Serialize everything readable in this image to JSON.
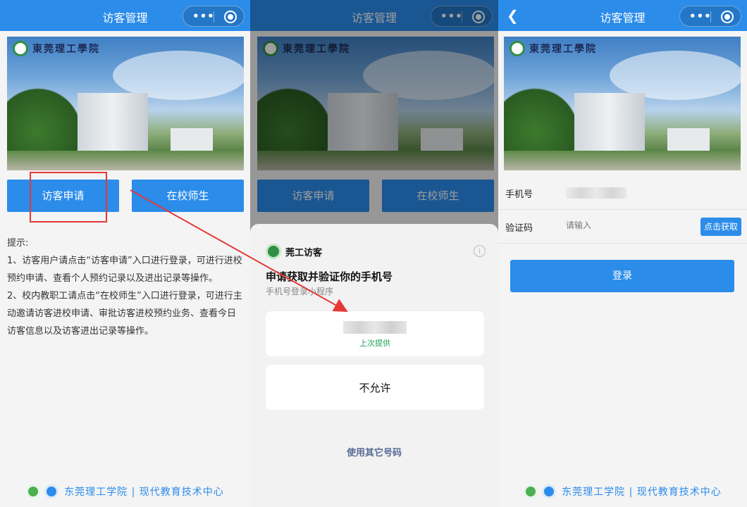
{
  "screen1": {
    "nav_title": "访客管理",
    "banner_logo_text": "東莞理工學院",
    "buttons": {
      "visitor_apply": "访客申请",
      "staff": "在校师生"
    },
    "tips_title": "提示:",
    "tip1": "1、访客用户请点击“访客申请”入口进行登录，可进行进校预约申请、查看个人预约记录以及进出记录等操作。",
    "tip2": "2、校内教职工请点击“在校师生”入口进行登录，可进行主动邀请访客进校申请、审批访客进校预约业务、查看今日访客信息以及访客进出记录等操作。",
    "footer": "东莞理工学院 | 现代教育技术中心"
  },
  "screen2": {
    "nav_title": "访客管理",
    "banner_logo_text": "東莞理工學院",
    "buttons": {
      "visitor_apply": "访客申请",
      "staff": "在校师生"
    },
    "app_name": "莞工访客",
    "request_title": "申请获取并验证你的手机号",
    "request_subtitle": "手机号登录小程序",
    "last_used": "上次提供",
    "deny": "不允许",
    "use_other": "使用其它号码"
  },
  "screen3": {
    "nav_title": "访客管理",
    "banner_logo_text": "東莞理工學院",
    "phone_label": "手机号",
    "code_label": "验证码",
    "code_placeholder": "请输入",
    "get_code": "点击获取",
    "login": "登录",
    "footer": "东莞理工学院 | 现代教育技术中心"
  },
  "colors": {
    "primary": "#2b8cea",
    "annotation": "#e53935",
    "green": "#23a05a"
  },
  "icons": [
    "more-dots-icon",
    "close-target-icon",
    "back-arrow-icon",
    "info-icon",
    "school-logo-icon"
  ]
}
